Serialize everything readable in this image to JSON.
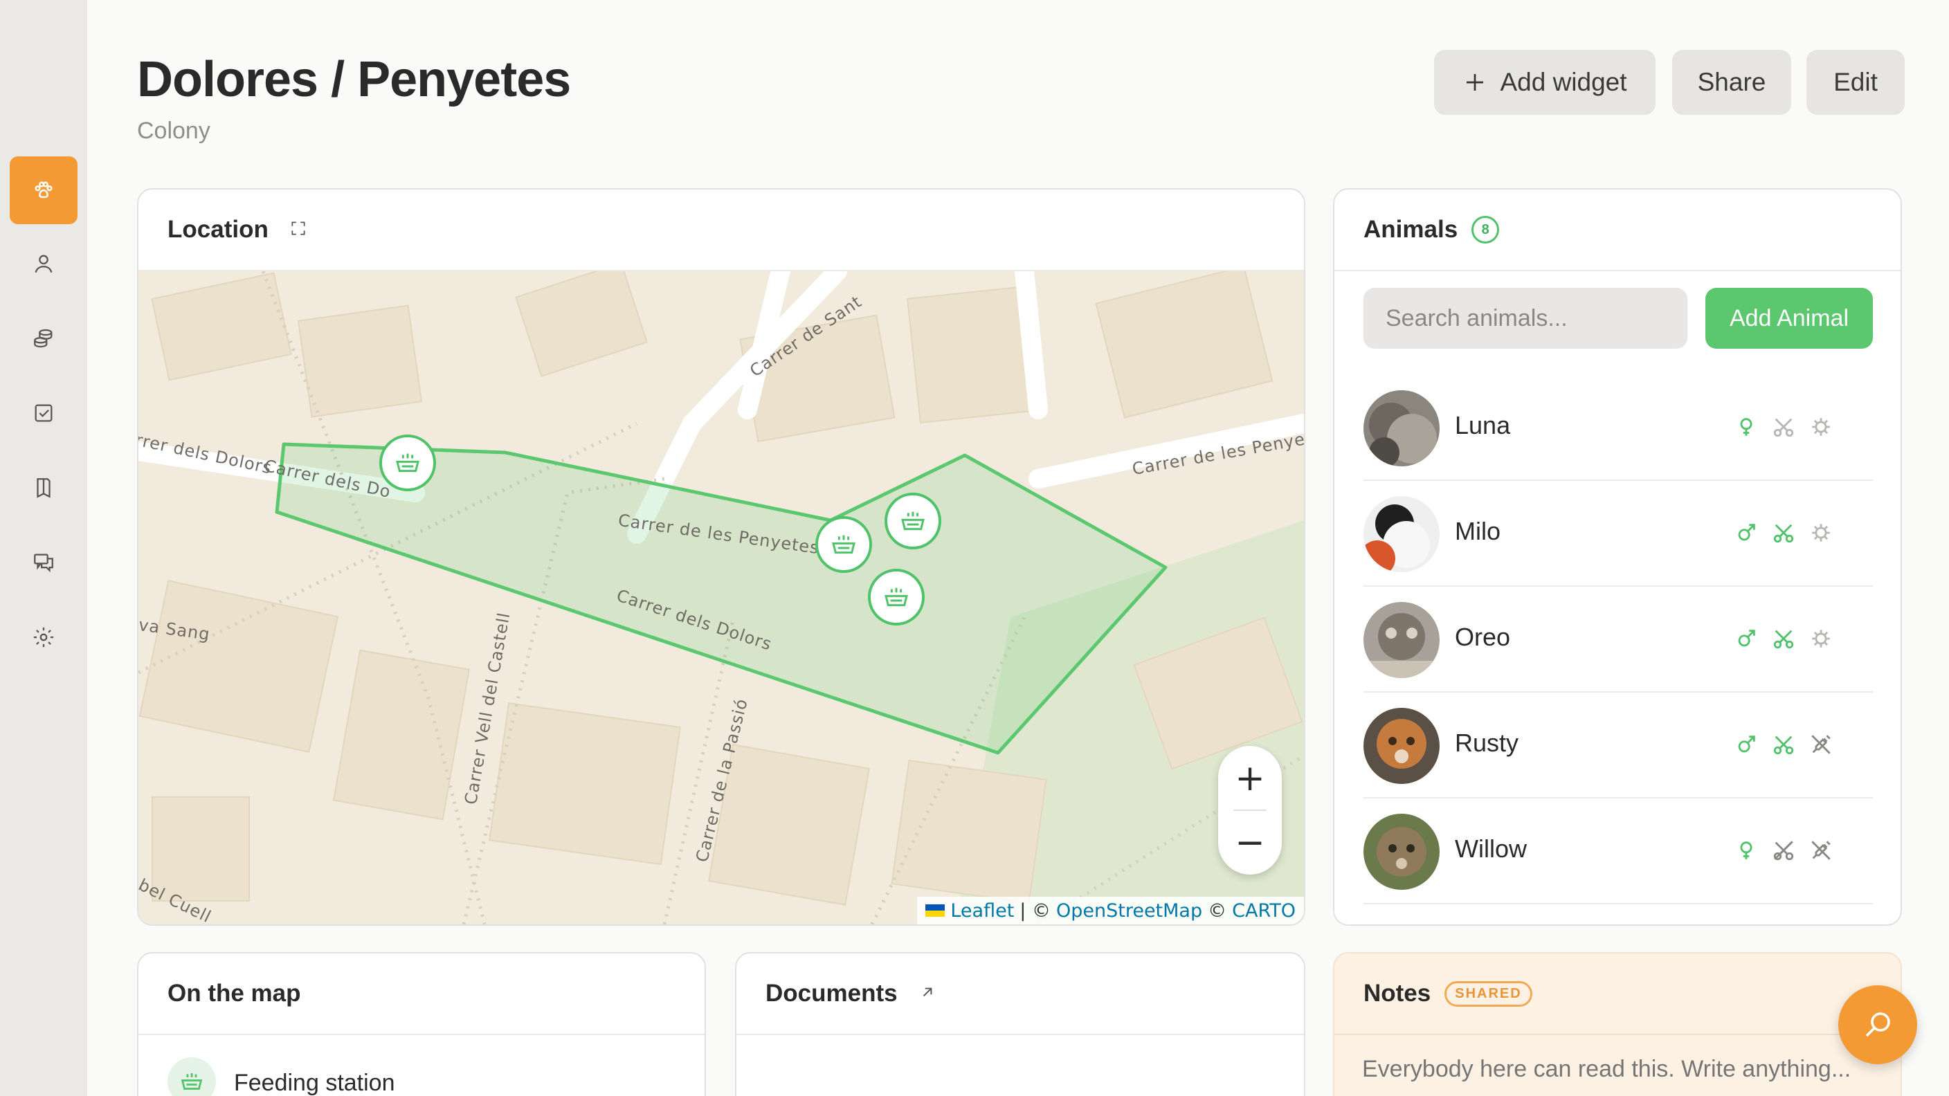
{
  "header": {
    "title": "Dolores / Penyetes",
    "subtitle": "Colony",
    "add_widget_label": "Add widget",
    "share_label": "Share",
    "edit_label": "Edit"
  },
  "sidebar": {
    "items": [
      {
        "icon": "paw-icon",
        "active": true
      },
      {
        "icon": "user-icon",
        "active": false
      },
      {
        "icon": "coins-icon",
        "active": false
      },
      {
        "icon": "checkbox-icon",
        "active": false
      },
      {
        "icon": "book-icon",
        "active": false
      },
      {
        "icon": "chat-icon",
        "active": false
      },
      {
        "icon": "gear-icon",
        "active": false
      }
    ]
  },
  "location": {
    "title": "Location",
    "streets": [
      "Carrer de Sant",
      "rrer dels Dolors",
      "Carrer dels Do",
      "Carrer de les Penyetes",
      "Carrer de les Penyete",
      "Carrer dels Dolors",
      "va Sang",
      "Carrer Vell del Castell",
      "Carrer de la Passió",
      "bel Cuell"
    ],
    "attribution": {
      "leaflet": "Leaflet",
      "sep1": "| ©",
      "osm": "OpenStreetMap",
      "sep2": "©",
      "carto": "CARTO"
    },
    "zoom_in": "+",
    "zoom_out": "−"
  },
  "animals": {
    "title": "Animals",
    "count": "8",
    "search_placeholder": "Search animals...",
    "add_label": "Add Animal",
    "list": [
      {
        "name": "Luna",
        "sex": "female",
        "sterilized": false,
        "settings": false
      },
      {
        "name": "Milo",
        "sex": "male",
        "sterilized": true,
        "settings": false
      },
      {
        "name": "Oreo",
        "sex": "male",
        "sterilized": true,
        "settings": false
      },
      {
        "name": "Rusty",
        "sex": "male",
        "sterilized": true,
        "settings": "disabled"
      },
      {
        "name": "Willow",
        "sex": "female",
        "sterilized": "disabled",
        "settings": "disabled"
      }
    ]
  },
  "on_the_map": {
    "title": "On the map",
    "items": [
      {
        "label": "Feeding station",
        "icon": "feeding-bowl-icon"
      }
    ]
  },
  "documents": {
    "title": "Documents"
  },
  "notes": {
    "title": "Notes",
    "badge": "SHARED",
    "placeholder": "Everybody here can read this. Write anything..."
  },
  "colors": {
    "accent": "#f39a34",
    "green": "#5bc870",
    "map_bg": "#f2ebdd"
  }
}
